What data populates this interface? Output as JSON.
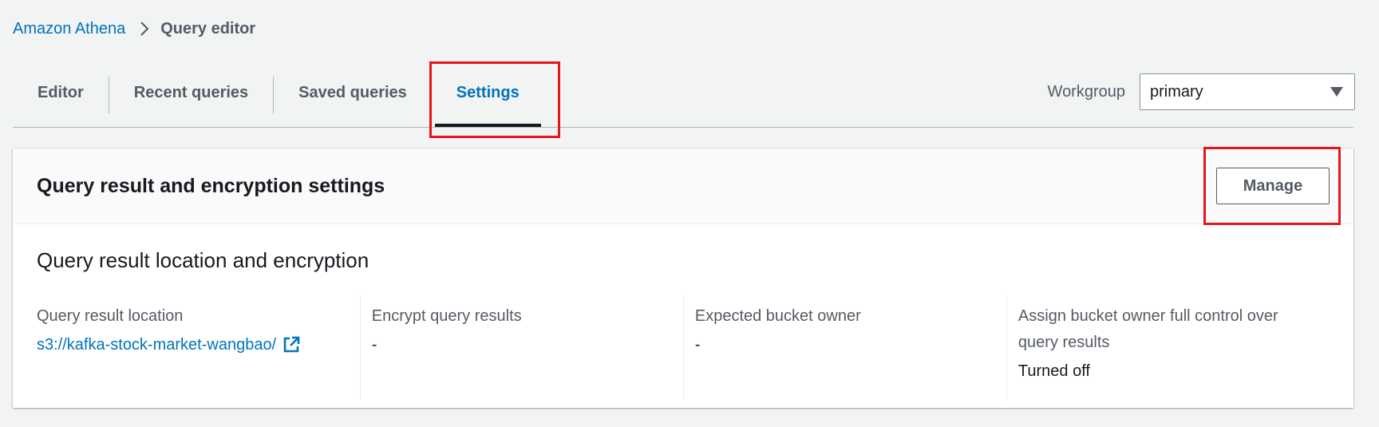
{
  "breadcrumb": {
    "root": "Amazon Athena",
    "current": "Query editor"
  },
  "tabs": [
    {
      "label": "Editor",
      "active": false
    },
    {
      "label": "Recent queries",
      "active": false
    },
    {
      "label": "Saved queries",
      "active": false
    },
    {
      "label": "Settings",
      "active": true
    }
  ],
  "workgroup": {
    "label": "Workgroup",
    "selected": "primary"
  },
  "panel": {
    "title": "Query result and encryption settings",
    "manage_label": "Manage",
    "section_title": "Query result location and encryption",
    "fields": [
      {
        "label": "Query result location",
        "value": "s3://kafka-stock-market-wangbao/",
        "is_link": true,
        "icon": "external-link-icon"
      },
      {
        "label": "Encrypt query results",
        "value": "-"
      },
      {
        "label": "Expected bucket owner",
        "value": "-"
      },
      {
        "label": "Assign bucket owner full control over query results",
        "value": "Turned off"
      }
    ]
  },
  "colors": {
    "link": "#0073bb",
    "highlight": "#e3161d",
    "background": "#f2f3f3"
  }
}
